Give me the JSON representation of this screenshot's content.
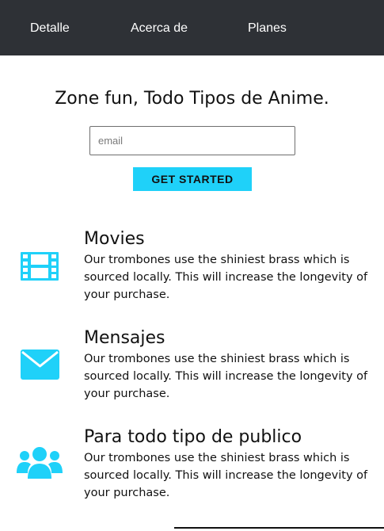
{
  "nav": {
    "items": [
      {
        "label": "Detalle"
      },
      {
        "label": "Acerca de"
      },
      {
        "label": "Planes"
      }
    ]
  },
  "hero": {
    "title": "Zone fun, Todo Tipos de Anime.",
    "email_placeholder": "email",
    "email_value": "",
    "cta_label": "GET STARTED"
  },
  "features": [
    {
      "icon": "film-icon",
      "title": "Movies",
      "description": "Our trombones use the shiniest brass which is sourced locally. This will increase the longevity of your purchase."
    },
    {
      "icon": "envelope-icon",
      "title": "Mensajes",
      "description": "Our trombones use the shiniest brass which is sourced locally. This will increase the longevity of your purchase."
    },
    {
      "icon": "users-icon",
      "title": "Para todo tipo de publico",
      "description": "Our trombones use the shiniest brass which is sourced locally. This will increase the longevity of your purchase."
    }
  ],
  "colors": {
    "navbar_bg": "#2e3136",
    "accent": "#1fd1f9",
    "text": "#111111"
  }
}
